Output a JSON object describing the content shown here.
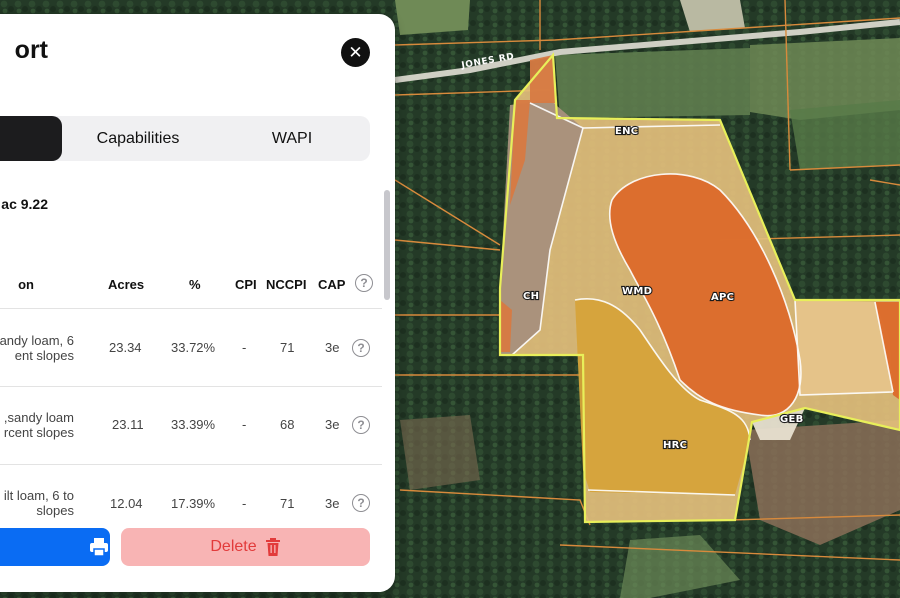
{
  "panel": {
    "title": "ort",
    "close_icon": "close-icon",
    "tabs": [
      {
        "label": "",
        "active": true
      },
      {
        "label": "Capabilities",
        "active": false
      },
      {
        "label": "WAPI",
        "active": false
      }
    ],
    "acres_total": "9.22 ac",
    "table": {
      "headers": {
        "description": "on",
        "acres": "Acres",
        "percent": "%",
        "cpi": "CPI",
        "nccpi": "NCCPI",
        "cap": "CAP"
      },
      "rows": [
        {
          "desc_line1": "andy loam, 6",
          "desc_line2": "ent slopes",
          "acres": "23.34",
          "percent": "33.72%",
          "cpi": "-",
          "nccpi": "71",
          "cap": "3e"
        },
        {
          "desc_line1": "sandy loam,",
          "desc_line2": "rcent slopes",
          "acres": "23.11",
          "percent": "33.39%",
          "cpi": "-",
          "nccpi": "68",
          "cap": "3e"
        },
        {
          "desc_line1": "ilt loam, 6 to",
          "desc_line2": "slopes",
          "acres": "12.04",
          "percent": "17.39%",
          "cpi": "-",
          "nccpi": "71",
          "cap": "3e"
        }
      ]
    },
    "buttons": {
      "print_icon": "printer-icon",
      "delete_label": "Delete",
      "delete_icon": "trash-icon"
    }
  },
  "map": {
    "road_label": "JONES RD",
    "soil_labels": [
      "ENC",
      "CH",
      "WMD",
      "APC",
      "GEB",
      "HRC"
    ],
    "colors": {
      "field_outline": "#e8ef5a",
      "parcel_lines": "#d88a3c",
      "apc": "#dc6a2a",
      "wmd": "#e8be77",
      "hrc": "#d6a33a",
      "ch": "#a58e7a"
    }
  }
}
